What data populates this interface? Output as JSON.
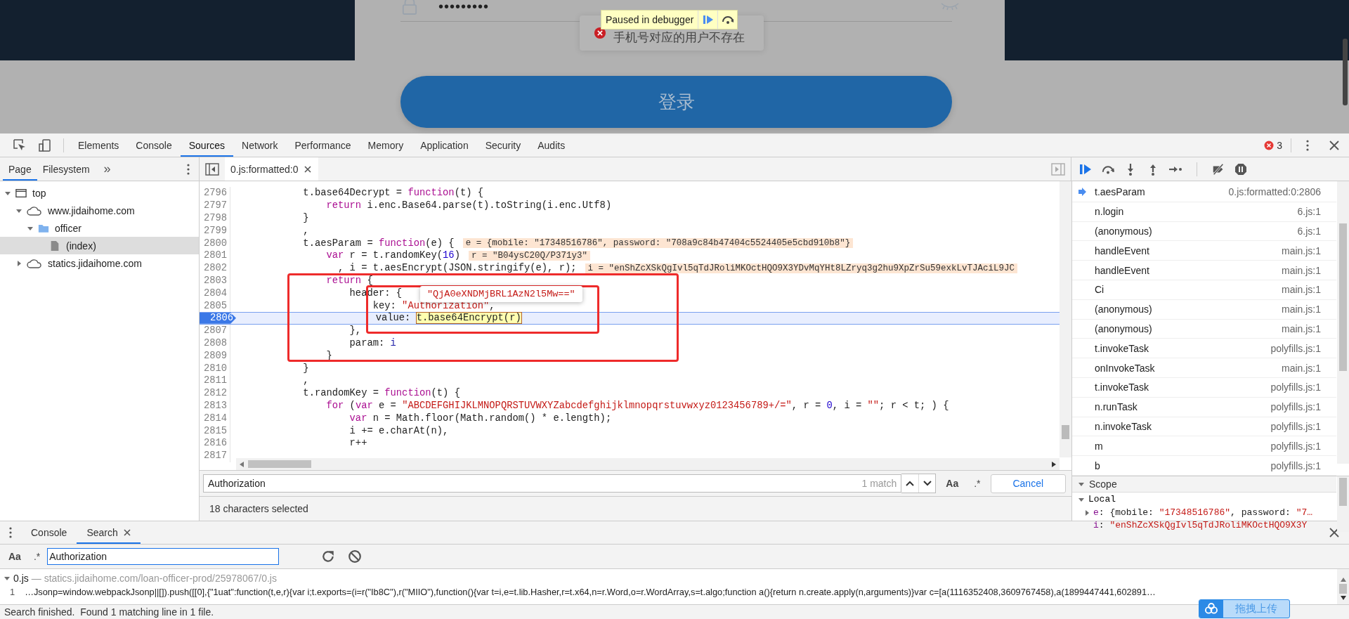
{
  "page": {
    "password_mask": "•••••••••",
    "toast": "手机号对应的用户不存在",
    "debugger_banner": "Paused in debugger",
    "login_button": "登录"
  },
  "devtools": {
    "tabs": [
      {
        "label": "Elements",
        "selected": false
      },
      {
        "label": "Console",
        "selected": false
      },
      {
        "label": "Sources",
        "selected": true
      },
      {
        "label": "Network",
        "selected": false
      },
      {
        "label": "Performance",
        "selected": false
      },
      {
        "label": "Memory",
        "selected": false
      },
      {
        "label": "Application",
        "selected": false
      },
      {
        "label": "Security",
        "selected": false
      },
      {
        "label": "Audits",
        "selected": false
      }
    ],
    "error_count": "3"
  },
  "navigator": {
    "tabs": [
      {
        "label": "Page",
        "selected": true
      },
      {
        "label": "Filesystem",
        "selected": false
      }
    ],
    "more": "»",
    "tree": [
      {
        "label": "top",
        "kind": "frame",
        "selected": false,
        "expanded": true,
        "children": [
          {
            "label": "www.jidaihome.com",
            "kind": "domain",
            "selected": false,
            "expanded": true,
            "children": [
              {
                "label": "officer",
                "kind": "folder",
                "selected": false,
                "expanded": true,
                "children": [
                  {
                    "label": "(index)",
                    "kind": "file",
                    "selected": true
                  }
                ]
              }
            ]
          },
          {
            "label": "statics.jidaihome.com",
            "kind": "domain",
            "selected": false,
            "expanded": false
          }
        ]
      }
    ]
  },
  "editor": {
    "tab": "0.js:formatted:0",
    "lines": [
      {
        "number": "2796",
        "current": false,
        "segments": [
          {
            "text": "            t.base64Decrypt = ",
            "kind": "plain"
          },
          {
            "text": "function",
            "kind": "keyword"
          },
          {
            "text": "(t) {",
            "kind": "plain"
          }
        ]
      },
      {
        "number": "2797",
        "current": false,
        "segments": [
          {
            "text": "                return",
            "kind": "keyword"
          },
          {
            "text": " i.enc.Base64.parse(t).toString(i.enc.Utf8)",
            "kind": "plain"
          }
        ]
      },
      {
        "number": "2798",
        "current": false,
        "segments": [
          {
            "text": "            }",
            "kind": "plain"
          }
        ]
      },
      {
        "number": "2799",
        "current": false,
        "segments": [
          {
            "text": "            ,",
            "kind": "plain"
          }
        ]
      },
      {
        "number": "2800",
        "current": false,
        "segments": [
          {
            "text": "            t.aesParam = ",
            "kind": "plain"
          },
          {
            "text": "function",
            "kind": "keyword"
          },
          {
            "text": "(e) {",
            "kind": "plain"
          }
        ],
        "inline_value": "e = {mobile: \"17348516786\", password: \"708a9c84b47404c5524405e5cbd910b8\"}"
      },
      {
        "number": "2801",
        "current": false,
        "segments": [
          {
            "text": "                var",
            "kind": "keyword"
          },
          {
            "text": " r = t.randomKey(",
            "kind": "plain"
          },
          {
            "text": "16",
            "kind": "number"
          },
          {
            "text": ")",
            "kind": "plain"
          }
        ],
        "inline_value": "r = \"B04ysC20Q/P371y3\""
      },
      {
        "number": "2802",
        "current": false,
        "segments": [
          {
            "text": "                  , i = t.aesEncrypt(JSON.stringify(e), r);",
            "kind": "plain"
          }
        ],
        "inline_value": "i = \"enShZcXSkQgIvl5qTdJRoliMKOctHQO9X3YDvMqYHt8LZryq3g2hu9XpZrSu59exkLvTJAciL9JC"
      },
      {
        "number": "2803",
        "current": false,
        "segments": [
          {
            "text": "                return",
            "kind": "keyword"
          },
          {
            "text": " {",
            "kind": "plain"
          }
        ]
      },
      {
        "number": "2804",
        "current": false,
        "segments": [
          {
            "text": "                    header: {",
            "kind": "plain"
          }
        ],
        "tooltip": "\"QjA0eXNDMjBRL1AzN2l5Mw==\""
      },
      {
        "number": "2805",
        "current": false,
        "segments": [
          {
            "text": "                        key: ",
            "kind": "plain"
          },
          {
            "text": "\"Authorization\"",
            "kind": "string"
          },
          {
            "text": ",",
            "kind": "plain"
          }
        ]
      },
      {
        "number": "2806",
        "current": true,
        "segments": [
          {
            "text": "                        value: ",
            "kind": "plain"
          },
          {
            "text": "t.base64Encrypt(r)",
            "kind": "highlight"
          }
        ]
      },
      {
        "number": "2807",
        "current": false,
        "segments": [
          {
            "text": "                    },",
            "kind": "plain"
          }
        ]
      },
      {
        "number": "2808",
        "current": false,
        "segments": [
          {
            "text": "                    param: ",
            "kind": "plain"
          },
          {
            "text": "i",
            "kind": "variable"
          }
        ]
      },
      {
        "number": "2809",
        "current": false,
        "segments": [
          {
            "text": "                }",
            "kind": "plain"
          }
        ]
      },
      {
        "number": "2810",
        "current": false,
        "segments": [
          {
            "text": "            }",
            "kind": "plain"
          }
        ]
      },
      {
        "number": "2811",
        "current": false,
        "segments": [
          {
            "text": "            ,",
            "kind": "plain"
          }
        ]
      },
      {
        "number": "2812",
        "current": false,
        "segments": [
          {
            "text": "            t.randomKey = ",
            "kind": "plain"
          },
          {
            "text": "function",
            "kind": "keyword"
          },
          {
            "text": "(t) {",
            "kind": "plain"
          }
        ]
      },
      {
        "number": "2813",
        "current": false,
        "segments": [
          {
            "text": "                for",
            "kind": "keyword"
          },
          {
            "text": " (",
            "kind": "plain"
          },
          {
            "text": "var",
            "kind": "keyword"
          },
          {
            "text": " e = ",
            "kind": "plain"
          },
          {
            "text": "\"ABCDEFGHIJKLMNOPQRSTUVWXYZabcdefghijklmnopqrstuvwxyz0123456789+/=\"",
            "kind": "string"
          },
          {
            "text": ", r = ",
            "kind": "plain"
          },
          {
            "text": "0",
            "kind": "number"
          },
          {
            "text": ", i = ",
            "kind": "plain"
          },
          {
            "text": "\"\"",
            "kind": "string"
          },
          {
            "text": "; r < t; ) {",
            "kind": "plain"
          }
        ]
      },
      {
        "number": "2814",
        "current": false,
        "segments": [
          {
            "text": "                    var",
            "kind": "keyword"
          },
          {
            "text": " n = Math.floor(Math.random() * e.length);",
            "kind": "plain"
          }
        ]
      },
      {
        "number": "2815",
        "current": false,
        "segments": [
          {
            "text": "                    i += e.charAt(n),",
            "kind": "plain"
          }
        ]
      },
      {
        "number": "2816",
        "current": false,
        "segments": [
          {
            "text": "                    r++",
            "kind": "plain"
          }
        ]
      },
      {
        "number": "2817",
        "current": false
      }
    ],
    "find": {
      "value": "Authorization",
      "match_count": "1 match",
      "case_toggle": "Aa",
      "regex_toggle": ".*",
      "cancel": "Cancel"
    },
    "selection_status": "18 characters selected"
  },
  "call_stack": [
    {
      "name": "t.aesParam",
      "location": "0.js:formatted:0:2806",
      "selected": true
    },
    {
      "name": "n.login",
      "location": "6.js:1",
      "selected": false
    },
    {
      "name": "(anonymous)",
      "location": "6.js:1",
      "selected": false
    },
    {
      "name": "handleEvent",
      "location": "main.js:1",
      "selected": false
    },
    {
      "name": "handleEvent",
      "location": "main.js:1",
      "selected": false
    },
    {
      "name": "Ci",
      "location": "main.js:1",
      "selected": false
    },
    {
      "name": "(anonymous)",
      "location": "main.js:1",
      "selected": false
    },
    {
      "name": "(anonymous)",
      "location": "main.js:1",
      "selected": false
    },
    {
      "name": "t.invokeTask",
      "location": "polyfills.js:1",
      "selected": false
    },
    {
      "name": "onInvokeTask",
      "location": "main.js:1",
      "selected": false
    },
    {
      "name": "t.invokeTask",
      "location": "polyfills.js:1",
      "selected": false
    },
    {
      "name": "n.runTask",
      "location": "polyfills.js:1",
      "selected": false
    },
    {
      "name": "n.invokeTask",
      "location": "polyfills.js:1",
      "selected": false
    },
    {
      "name": "m",
      "location": "polyfills.js:1",
      "selected": false
    },
    {
      "name": "b",
      "location": "polyfills.js:1",
      "selected": false
    }
  ],
  "scope": {
    "title": "Scope",
    "local": "Local",
    "entries": [
      {
        "name": "e",
        "expandable": true,
        "segments": [
          {
            "text": ": {mobile: ",
            "kind": "plain"
          },
          {
            "text": "\"17348516786\"",
            "kind": "string"
          },
          {
            "text": ", password: ",
            "kind": "plain"
          },
          {
            "text": "\"7…",
            "kind": "string"
          }
        ]
      },
      {
        "name": "i",
        "expandable": false,
        "segments": [
          {
            "text": ": ",
            "kind": "plain"
          },
          {
            "text": "\"enShZcXSkQgIvl5qTdJRoliMKOctHQO9X3Y",
            "kind": "string"
          }
        ]
      }
    ]
  },
  "drawer": {
    "tabs": [
      {
        "label": "Console",
        "selected": false,
        "closable": false
      },
      {
        "label": "Search",
        "selected": true,
        "closable": true
      }
    ],
    "search": {
      "case_toggle": "Aa",
      "regex_toggle": ".*",
      "value": "Authorization"
    },
    "results": [
      {
        "file": "0.js",
        "path": "— statics.jidaihome.com/loan-officer-prod/25978067/0.js",
        "matches": [
          {
            "line": "1",
            "text": "…Jsonp=window.webpackJsonp||[]).push([[0],{\"1uat\":function(t,e,r){var i;t.exports=(i=r(\"Ib8C\"),r(\"MIIO\"),function(){var t=i,e=t.lib.Hasher,r=t.x64,n=r.Word,o=r.WordArray,s=t.algo;function a(){return n.create.apply(n,arguments)}var c=[a(1116352408,3609767458),a(1899447441,602891…"
          }
        ]
      }
    ],
    "status": "Search finished.  Found 1 matching line in 1 file."
  },
  "upload_button": "拖拽上传"
}
